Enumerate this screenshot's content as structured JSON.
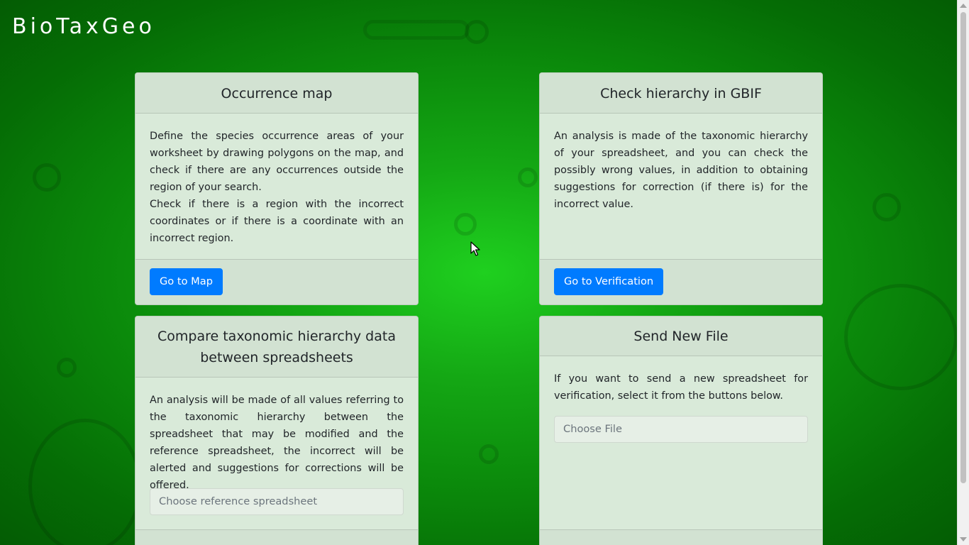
{
  "app": {
    "brand": "BioTaxGeo"
  },
  "cards": {
    "occurrence_map": {
      "title": "Occurrence map",
      "paragraph1": "Define the species occurrence areas of your worksheet by drawing polygons on the map, and check if there are any occurrences outside the region of your search.",
      "paragraph2": "Check if there is a region with the incorrect coordinates or if there is a coordinate with an incorrect region.",
      "button_label": "Go to Map"
    },
    "check_hierarchy": {
      "title": "Check hierarchy in GBIF",
      "paragraph1": "An analysis is made of the taxonomic hierarchy of your spreadsheet, and you can check the possibly wrong values, in addition to obtaining suggestions for correction (if there is) for the incorrect value.",
      "button_label": "Go to Verification"
    },
    "compare_hierarchy": {
      "title_line1": "Compare taxonomic hierarchy data",
      "title_line2": "between spreadsheets",
      "paragraph1": "An analysis will be made of all values referring to the taxonomic hierarchy between the spreadsheet that may be modified and the reference spreadsheet, the incorrect will be alerted and suggestions for corrections will be offered.",
      "file_placeholder": "Choose reference spreadsheet"
    },
    "send_new_file": {
      "title": "Send New File",
      "paragraph1": "If you want to send a new spreadsheet for verification, select it from the buttons below.",
      "file_placeholder": "Choose File"
    }
  },
  "colors": {
    "background_center": "#1fd01f",
    "background_edge": "#045c04",
    "card_background": "#d9ead9",
    "primary_button": "#007bff"
  },
  "icons": {
    "cursor": "mouse-pointer-icon",
    "scroll_up": "scroll-up-arrow-icon",
    "scroll_down": "scroll-down-arrow-icon"
  }
}
